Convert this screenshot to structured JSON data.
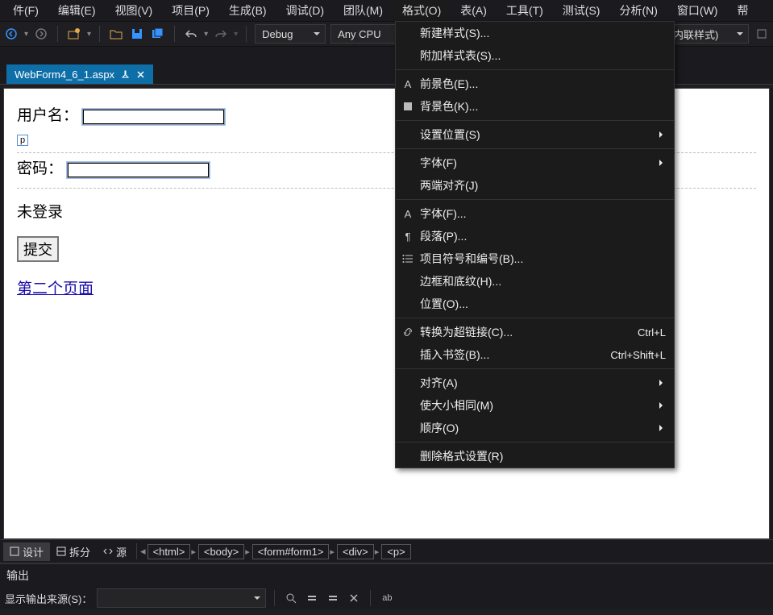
{
  "menu": {
    "items": [
      "件(F)",
      "编辑(E)",
      "视图(V)",
      "项目(P)",
      "生成(B)",
      "调试(D)",
      "团队(M)",
      "格式(O)",
      "表(A)",
      "工具(T)",
      "测试(S)",
      "分析(N)",
      "窗口(W)",
      "帮"
    ],
    "active_index": 7
  },
  "toolbar": {
    "config": "Debug",
    "platform": "Any CPU",
    "right_label": "建内联样式)"
  },
  "tab": {
    "title": "WebForm4_6_1.aspx"
  },
  "design": {
    "username_label": "用户名：",
    "p_tag": "p",
    "password_label": "密码：",
    "status_text": "未登录",
    "submit_label": "提交",
    "link_label": "第二个页面"
  },
  "dropdown": [
    {
      "icon": "",
      "label": "新建样式(S)...",
      "shortcut": "",
      "sub": false
    },
    {
      "icon": "",
      "label": "附加样式表(S)...",
      "shortcut": "",
      "sub": false
    },
    {
      "sep": true
    },
    {
      "icon": "A",
      "label": "前景色(E)...",
      "shortcut": "",
      "sub": false
    },
    {
      "icon": "fill",
      "label": "背景色(K)...",
      "shortcut": "",
      "sub": false
    },
    {
      "sep": true
    },
    {
      "icon": "",
      "label": "设置位置(S)",
      "shortcut": "",
      "sub": true
    },
    {
      "sep": true
    },
    {
      "icon": "",
      "label": "字体(F)",
      "shortcut": "",
      "sub": true
    },
    {
      "icon": "",
      "label": "两端对齐(J)",
      "shortcut": "",
      "sub": false
    },
    {
      "sep": true
    },
    {
      "icon": "A",
      "label": "字体(F)...",
      "shortcut": "",
      "sub": false
    },
    {
      "icon": "¶",
      "label": "段落(P)...",
      "shortcut": "",
      "sub": false
    },
    {
      "icon": "list",
      "label": "项目符号和编号(B)...",
      "shortcut": "",
      "sub": false
    },
    {
      "icon": "",
      "label": "边框和底纹(H)...",
      "shortcut": "",
      "sub": false
    },
    {
      "icon": "",
      "label": "位置(O)...",
      "shortcut": "",
      "sub": false
    },
    {
      "sep": true
    },
    {
      "icon": "link",
      "label": "转换为超链接(C)...",
      "shortcut": "Ctrl+L",
      "sub": false
    },
    {
      "icon": "",
      "label": "插入书签(B)...",
      "shortcut": "Ctrl+Shift+L",
      "sub": false
    },
    {
      "sep": true
    },
    {
      "icon": "",
      "label": "对齐(A)",
      "shortcut": "",
      "sub": true
    },
    {
      "icon": "",
      "label": "使大小相同(M)",
      "shortcut": "",
      "sub": true
    },
    {
      "icon": "",
      "label": "顺序(O)",
      "shortcut": "",
      "sub": true
    },
    {
      "sep": true
    },
    {
      "icon": "",
      "label": "删除格式设置(R)",
      "shortcut": "",
      "sub": false
    }
  ],
  "viewbar": {
    "design": "设计",
    "split": "拆分",
    "source": "源",
    "breadcrumb": [
      "<html>",
      "<body>",
      "<form#form1>",
      "<div>",
      "<p>"
    ]
  },
  "output": {
    "title": "输出",
    "src_label": "显示输出来源(S)："
  }
}
